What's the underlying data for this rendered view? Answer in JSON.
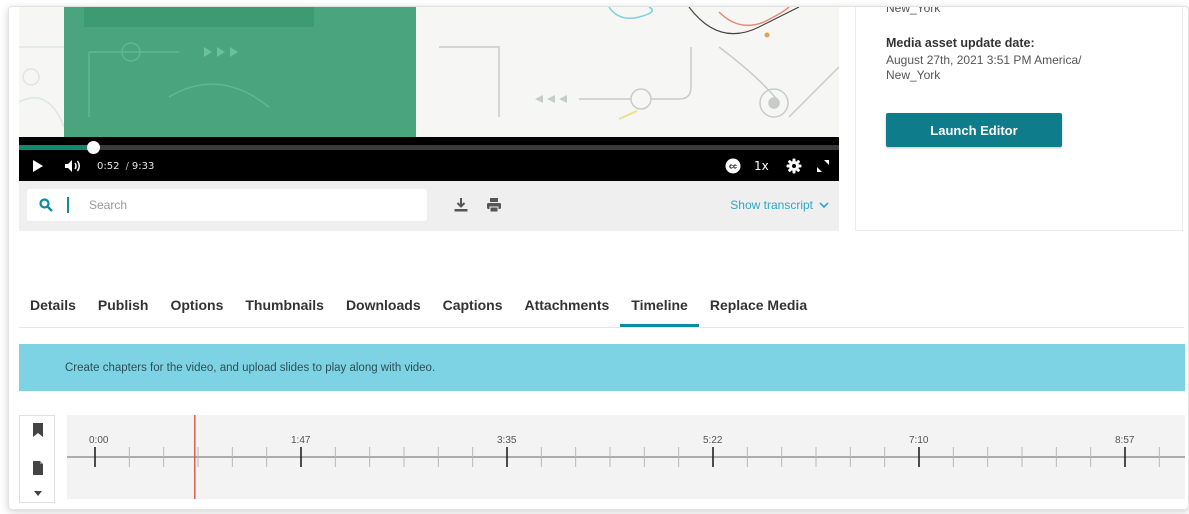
{
  "player": {
    "time_current": "0:52",
    "time_total": "9:33",
    "progress": 0.0907,
    "speed_label": "1x",
    "colors": {
      "accent": "#0f8a6f",
      "bar": "#000000"
    }
  },
  "search": {
    "placeholder": "Search",
    "value": "",
    "show_transcript_label": "Show transcript"
  },
  "info_panel": {
    "cut_line": "New_York",
    "update_label": "Media asset update date:",
    "update_value": "August 27th, 2021 3:51 PM America/ New_York",
    "launch_label": "Launch Editor"
  },
  "tabs": [
    {
      "label": "Details",
      "active": false
    },
    {
      "label": "Publish",
      "active": false
    },
    {
      "label": "Options",
      "active": false
    },
    {
      "label": "Thumbnails",
      "active": false
    },
    {
      "label": "Downloads",
      "active": false
    },
    {
      "label": "Captions",
      "active": false
    },
    {
      "label": "Attachments",
      "active": false
    },
    {
      "label": "Timeline",
      "active": true
    },
    {
      "label": "Replace Media",
      "active": false
    }
  ],
  "banner": {
    "text": "Create chapters for the video, and upload slides to play along with video."
  },
  "timeline": {
    "duration_seconds": 573,
    "playhead_seconds": 52,
    "major_labels": [
      "0:00",
      "1:47",
      "3:35",
      "5:22",
      "7:10",
      "8:57"
    ],
    "playhead_color": "#e05a4e"
  },
  "icons": {
    "search": "search-icon",
    "download": "download-icon",
    "print": "printer-icon",
    "bookmark": "bookmark-icon",
    "slide": "file-icon",
    "more": "caret-down-icon"
  }
}
